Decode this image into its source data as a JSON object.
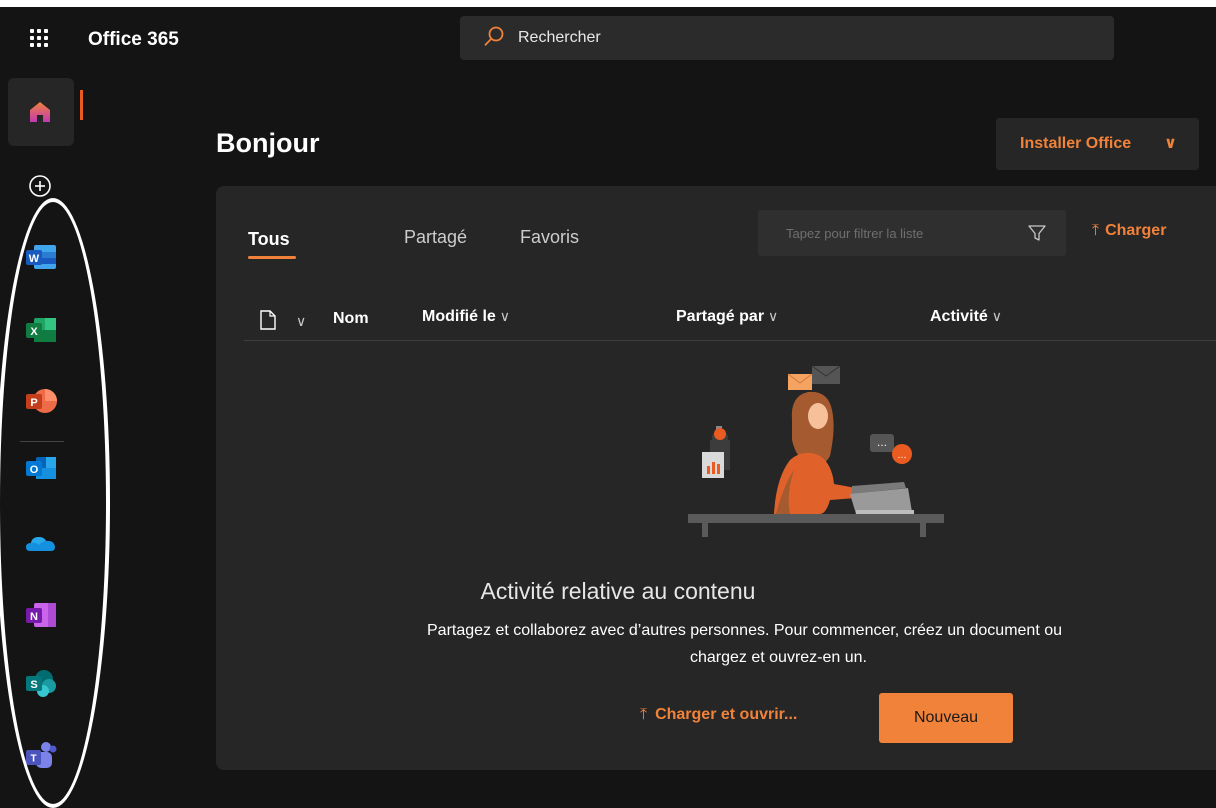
{
  "header": {
    "app_title": "Office 365",
    "search_placeholder": "Rechercher",
    "icons": {
      "launcher": "app-launcher-icon",
      "search": "search-icon"
    }
  },
  "rail": {
    "items": [
      {
        "name": "Accueil",
        "icon": "home-icon",
        "active": true
      },
      {
        "name": "Créer",
        "icon": "add-circle-icon"
      },
      {
        "name": "Word",
        "icon": "word-icon",
        "letter": "W"
      },
      {
        "name": "Excel",
        "icon": "excel-icon",
        "letter": "X"
      },
      {
        "name": "PowerPoint",
        "icon": "powerpoint-icon",
        "letter": "P"
      },
      {
        "name": "Outlook",
        "icon": "outlook-icon",
        "letter": "O"
      },
      {
        "name": "OneDrive",
        "icon": "onedrive-icon"
      },
      {
        "name": "OneNote",
        "icon": "onenote-icon",
        "letter": "N"
      },
      {
        "name": "SharePoint",
        "icon": "sharepoint-icon",
        "letter": "S"
      },
      {
        "name": "Teams",
        "icon": "teams-icon",
        "letter": "T"
      }
    ]
  },
  "main": {
    "greeting": "Bonjour",
    "install_button": {
      "label": "Installer Office",
      "chevron": "∨"
    },
    "tabs": [
      {
        "label": "Tous",
        "active": true
      },
      {
        "label": "Partagé",
        "active": false
      },
      {
        "label": "Favoris",
        "active": false
      }
    ],
    "filter_placeholder": "Tapez pour filtrer la liste",
    "upload_label": "Charger",
    "upload_arrow": "⤒",
    "columns": {
      "name": "Nom",
      "modified": "Modifié le",
      "shared_by": "Partagé par",
      "activity": "Activité",
      "chevron": "∨"
    },
    "empty_state": {
      "title": "Activité relative au contenu",
      "line1": "Partagez et collaborez avec d’autres personnes. Pour commencer, créez un document ou",
      "line2": "chargez et ouvrez-en un.",
      "upload_open_label": "Charger et ouvrir...",
      "new_label": "Nouveau"
    }
  },
  "colors": {
    "accent": "#f0823a",
    "background": "#141414",
    "card": "#262626",
    "home_active": "#ea5b21"
  }
}
